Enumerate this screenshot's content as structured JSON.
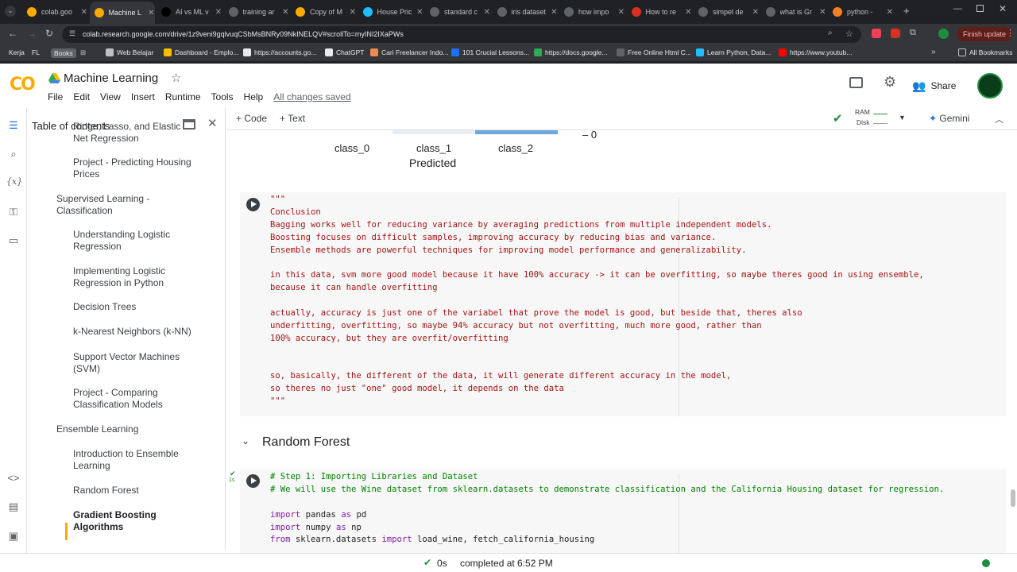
{
  "browser": {
    "tabs": [
      {
        "label": "colab.goo",
        "color": "#f9ab00",
        "active": false
      },
      {
        "label": "Machine L",
        "color": "#f9ab00",
        "active": true
      },
      {
        "label": "AI vs ML v",
        "color": "#000000",
        "active": false
      },
      {
        "label": "training ar",
        "color": "#5f6368",
        "active": false
      },
      {
        "label": "Copy of M",
        "color": "#f9ab00",
        "active": false
      },
      {
        "label": "House Pric",
        "color": "#20beff",
        "active": false
      },
      {
        "label": "standard c",
        "color": "#5f6368",
        "active": false
      },
      {
        "label": "iris dataset",
        "color": "#5f6368",
        "active": false
      },
      {
        "label": "how impo",
        "color": "#5f6368",
        "active": false
      },
      {
        "label": "How to re",
        "color": "#d93025",
        "active": false
      },
      {
        "label": "simpel de",
        "color": "#5f6368",
        "active": false
      },
      {
        "label": "what is Gr",
        "color": "#5f6368",
        "active": false
      },
      {
        "label": "python - ",
        "color": "#f48024",
        "active": false
      }
    ],
    "url": "colab.research.google.com/drive/1z9veni9gqlvuqCSbMsBNRy09NkINELQV#scrollTo=myINI2IXaPWs",
    "finish_update": "Finish update",
    "bookmarks": [
      "Kerja",
      "FL",
      "Books",
      "Web Belajar",
      "Dashboard - Emplo...",
      "https://accounts.go...",
      "ChatGPT",
      "Cari Freelancer Indo...",
      "101 Crucial Lessons...",
      "https://docs.google...",
      "Free Online Html C...",
      "Learn Python, Data...",
      "https://www.youtub..."
    ],
    "all_bookmarks": "All Bookmarks"
  },
  "colab": {
    "title": "Machine Learning",
    "menu": [
      "File",
      "Edit",
      "View",
      "Insert",
      "Runtime",
      "Tools",
      "Help"
    ],
    "saved": "All changes saved",
    "share": "Share",
    "toolbar": {
      "code": "+ Code",
      "text": "+ Text",
      "ram": "RAM",
      "disk": "Disk",
      "gemini": "Gemini"
    }
  },
  "toc": {
    "title": "Table of contents",
    "items": [
      "Ridge, Lasso, and Elastic Net Regression",
      "Project - Predicting Housing Prices",
      "Supervised Learning - Classification",
      "Understanding Logistic Regression",
      "Implementing Logistic Regression in Python",
      "Decision Trees",
      "k-Nearest Neighbors (k-NN)",
      "Support Vector Machines (SVM)",
      "Project - Comparing Classification Models",
      "Ensemble Learning",
      "Introduction to Ensemble Learning",
      "Random Forest",
      "Gradient Boosting Algorithms"
    ]
  },
  "output": {
    "labels": [
      "class_0",
      "class_1",
      "class_2"
    ],
    "axis": "Predicted",
    "colorbar_tick": "– 0"
  },
  "text_cell": {
    "lines": [
      "\"\"\"",
      "Conclusion",
      "Bagging works well for reducing variance by averaging predictions from multiple independent models.",
      "Boosting focuses on difficult samples, improving accuracy by reducing bias and variance.",
      "Ensemble methods are powerful techniques for improving model performance and generalizability.",
      "",
      "in this data, svm more good model because it have 100% accuracy -> it can be overfitting, so maybe theres good in using ensemble,",
      "because it can handle overfitting",
      "",
      "actually, accuracy is just one of the variabel that prove the model is good, but beside that, theres also",
      "underfitting, overfitting, so maybe 94% accuracy but not overfitting, much more good, rather than",
      "100% accuracy, but they are overfit/overfitting",
      "",
      "",
      "so, basically, the different of the data, it will generate different accuracy in the model,",
      "so theres no just \"one\" good model, it depends on the data",
      "\"\"\""
    ]
  },
  "section": {
    "title": "Random Forest"
  },
  "code_cell": {
    "exec_time": "1s",
    "lines": [
      {
        "type": "comment",
        "text": "# Step 1: Importing Libraries and Dataset"
      },
      {
        "type": "comment",
        "text": "# We will use the Wine dataset from sklearn.datasets to demonstrate classification and the California Housing dataset for regression."
      },
      {
        "type": "blank",
        "text": ""
      },
      {
        "type": "import",
        "kw1": "import",
        "rest1": " pandas ",
        "kw2": "as",
        "rest2": " pd"
      },
      {
        "type": "import",
        "kw1": "import",
        "rest1": " numpy ",
        "kw2": "as",
        "rest2": " np"
      },
      {
        "type": "import",
        "kw1": "from",
        "rest1": " sklearn.datasets ",
        "kw2": "import",
        "rest2": " load_wine, fetch_california_housing"
      }
    ]
  },
  "status": {
    "elapsed": "0s",
    "completed": "completed at 6:52 PM"
  }
}
